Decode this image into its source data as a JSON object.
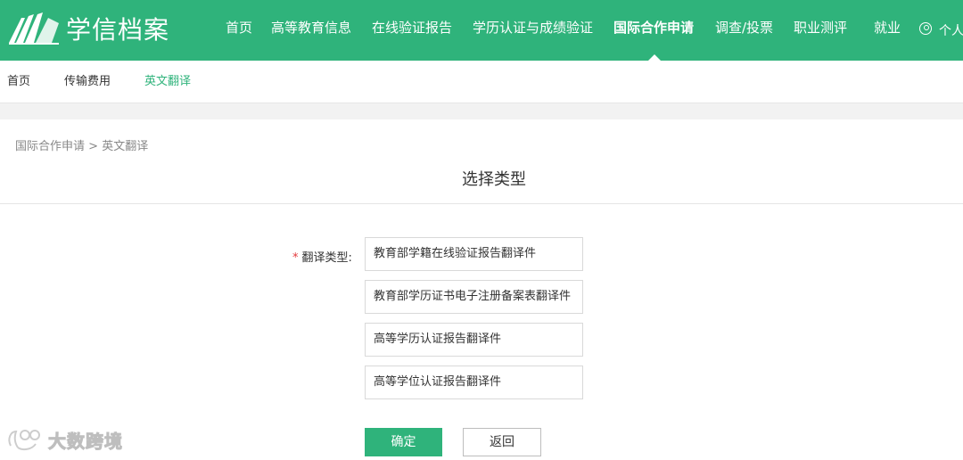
{
  "brand": {
    "name": "学信档案"
  },
  "nav": {
    "items": [
      {
        "label": "首页"
      },
      {
        "label": "高等教育信息"
      },
      {
        "label": "在线验证报告"
      },
      {
        "label": "学历认证与成绩验证"
      },
      {
        "label": "国际合作申请"
      },
      {
        "label": "调查/投票"
      },
      {
        "label": "职业测评"
      },
      {
        "label": "就业"
      }
    ],
    "active_index": 4,
    "user_label": "个人"
  },
  "subnav": {
    "items": [
      {
        "label": "首页"
      },
      {
        "label": "传输费用"
      },
      {
        "label": "英文翻译"
      }
    ],
    "active_index": 2
  },
  "breadcrumb": {
    "parent": "国际合作申请",
    "separator": ">",
    "current": "英文翻译"
  },
  "page_title": "选择类型",
  "form": {
    "required_mark": "*",
    "label": "翻译类型:",
    "options": [
      {
        "label": "教育部学籍在线验证报告翻译件"
      },
      {
        "label": "教育部学历证书电子注册备案表翻译件"
      },
      {
        "label": "高等学历认证报告翻译件"
      },
      {
        "label": "高等学位认证报告翻译件"
      }
    ],
    "confirm_label": "确定",
    "back_label": "返回"
  },
  "watermark": {
    "text": "大数跨境"
  },
  "colors": {
    "brand_green": "#2fb37b",
    "required_red": "#e4393c"
  }
}
